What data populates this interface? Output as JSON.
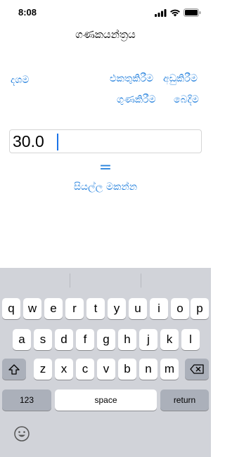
{
  "status": {
    "time": "8:08"
  },
  "app": {
    "title": "ගණකයන්ත්‍රය",
    "decimal_label": "දශම",
    "add_label": "එකතුකිරීම",
    "subtract_label": "අඩුකිරීම",
    "multiply_label": "ගුණකිරීම",
    "divide_label": "බෙදීම",
    "number_value": "30.0",
    "equals_label": "=",
    "clear_label": "සියල්ල මකන්න"
  },
  "keyboard": {
    "row1": [
      "q",
      "w",
      "e",
      "r",
      "t",
      "y",
      "u",
      "i",
      "o",
      "p"
    ],
    "row2": [
      "a",
      "s",
      "d",
      "f",
      "g",
      "h",
      "j",
      "k",
      "l"
    ],
    "row3": [
      "z",
      "x",
      "c",
      "v",
      "b",
      "n",
      "m"
    ],
    "numbers_label": "123",
    "space_label": "space",
    "return_label": "return"
  },
  "icons": [
    "wifi-icon",
    "signal-icon",
    "battery-icon",
    "shift-icon",
    "delete-icon",
    "emoji-icon"
  ],
  "colors": {
    "accent": "#2a84de",
    "keyboard_bg": "#d1d3d9",
    "key_dark": "#abb0ba"
  }
}
